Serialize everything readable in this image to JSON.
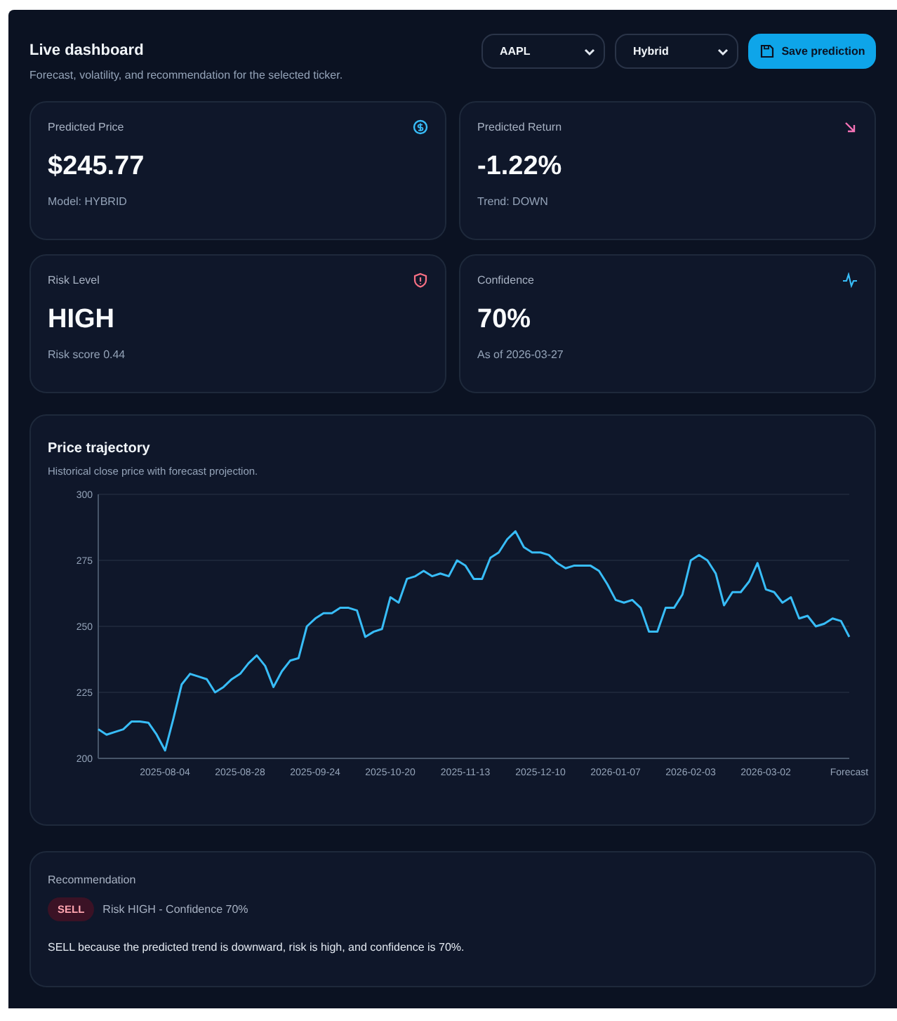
{
  "header": {
    "title": "Live dashboard",
    "subtitle": "Forecast, volatility, and recommendation for the selected ticker.",
    "ticker_select": {
      "value": "AAPL"
    },
    "model_select": {
      "value": "Hybrid"
    },
    "save_button": "Save prediction"
  },
  "metrics": [
    {
      "kind": "price",
      "label": "Predicted Price",
      "value": "$245.77",
      "note": "Model: HYBRID"
    },
    {
      "kind": "return",
      "label": "Predicted Return",
      "value": "-1.22%",
      "note": "Trend: DOWN"
    },
    {
      "kind": "risk",
      "label": "Risk Level",
      "value": "HIGH",
      "note": "Risk score 0.44"
    },
    {
      "kind": "confidence",
      "label": "Confidence",
      "value": "70%",
      "note": "As of 2026-03-27"
    }
  ],
  "chart_panel": {
    "title": "Price trajectory",
    "subtitle": "Historical close price with forecast projection.",
    "chart_data": {
      "type": "line",
      "categories": [
        null,
        null,
        null,
        null,
        null,
        null,
        null,
        null,
        "2025-08-04",
        null,
        null,
        null,
        null,
        null,
        null,
        null,
        null,
        "2025-08-28",
        null,
        null,
        null,
        null,
        null,
        null,
        null,
        null,
        "2025-09-24",
        null,
        null,
        null,
        null,
        null,
        null,
        null,
        null,
        "2025-10-20",
        null,
        null,
        null,
        null,
        null,
        null,
        null,
        null,
        "2025-11-13",
        null,
        null,
        null,
        null,
        null,
        null,
        null,
        null,
        "2025-12-10",
        null,
        null,
        null,
        null,
        null,
        null,
        null,
        null,
        "2026-01-07",
        null,
        null,
        null,
        null,
        null,
        null,
        null,
        null,
        "2026-02-03",
        null,
        null,
        null,
        null,
        null,
        null,
        null,
        null,
        "2026-03-02",
        null,
        null,
        null,
        null,
        null,
        null,
        null,
        null,
        null,
        "Forecast"
      ],
      "series": [
        {
          "color": "#38bdf8",
          "values": [
            211,
            209,
            210,
            211,
            214,
            214,
            213.5,
            209,
            203,
            215,
            228,
            232,
            231,
            230,
            225,
            227,
            230,
            232,
            236,
            239,
            235,
            227,
            233,
            237,
            238,
            250,
            253,
            255,
            255,
            257,
            257,
            256,
            246,
            248,
            249,
            261,
            259,
            268,
            269,
            271,
            269,
            270,
            269,
            275,
            273,
            268,
            268,
            276,
            278,
            283,
            286,
            280,
            278,
            278,
            277,
            274,
            272,
            273,
            273,
            273,
            271,
            266,
            260,
            259,
            260,
            257,
            248,
            248,
            257,
            257,
            262,
            275,
            277,
            275,
            270,
            258,
            263,
            263,
            267,
            274,
            264,
            263,
            259,
            261,
            253,
            254,
            250,
            251,
            253,
            252,
            246
          ]
        }
      ],
      "ylim": [
        200,
        300
      ],
      "yticks": [
        200,
        225,
        250,
        275,
        300
      ],
      "grid": true
    }
  },
  "recommendation": {
    "title": "Recommendation",
    "action": {
      "kind": "sell",
      "label": "SELL"
    },
    "summary": "Risk HIGH - Confidence 70%",
    "explanation": "SELL because the predicted trend is downward, risk is high, and confidence is 70%."
  }
}
